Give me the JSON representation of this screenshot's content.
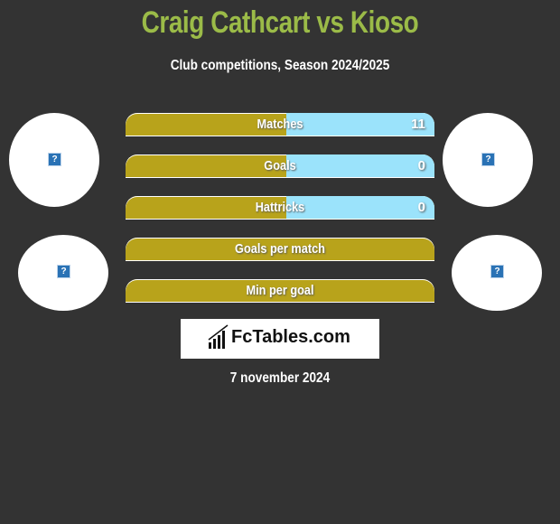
{
  "header": {
    "title": "Craig Cathcart vs Kioso",
    "subtitle": "Club competitions, Season 2024/2025"
  },
  "players": {
    "left": {
      "avatar_icon": "broken-image-icon",
      "glyph": "?"
    },
    "right": {
      "avatar_icon": "broken-image-icon",
      "glyph": "?"
    }
  },
  "stats": [
    {
      "label": "Matches",
      "left": "",
      "right": "11",
      "right_fraction": 0.48
    },
    {
      "label": "Goals",
      "left": "",
      "right": "0",
      "right_fraction": 0.48
    },
    {
      "label": "Hattricks",
      "left": "",
      "right": "0",
      "right_fraction": 0.48
    },
    {
      "label": "Goals per match",
      "left": "",
      "right": "",
      "right_fraction": 0
    },
    {
      "label": "Min per goal",
      "left": "",
      "right": "",
      "right_fraction": 0
    }
  ],
  "brand": {
    "name": "FcTables.com"
  },
  "date": "7 november 2024",
  "colors": {
    "title": "#9bbb48",
    "left_bar": "#b8a31b",
    "right_bar": "#9be3fb",
    "background": "#333333"
  }
}
